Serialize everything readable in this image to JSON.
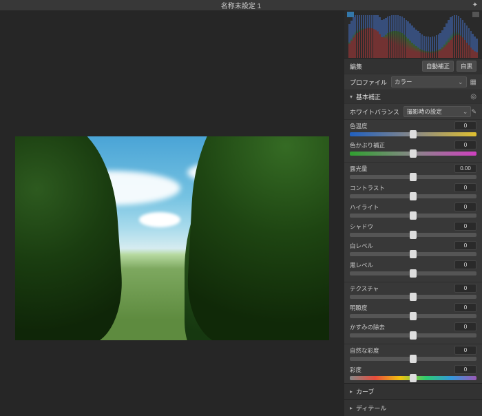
{
  "title": "名称未設定 1",
  "icons": {
    "gear": "✦"
  },
  "edit": {
    "header": "編集",
    "auto": "自動補正",
    "bw": "白黒",
    "profile_label": "プロファイル",
    "profile_value": "カラー"
  },
  "basic": {
    "title": "基本補正",
    "wb_label": "ホワイトバランス",
    "wb_value": "撮影時の設定",
    "sliders": [
      {
        "key": "temp",
        "label": "色温度",
        "value": "0",
        "cls": "temp",
        "pos": 50
      },
      {
        "key": "tint",
        "label": "色かぶり補正",
        "value": "0",
        "cls": "tint",
        "pos": 50
      }
    ],
    "group2": [
      {
        "key": "exposure",
        "label": "露光量",
        "value": "0.00",
        "pos": 50
      },
      {
        "key": "contrast",
        "label": "コントラスト",
        "value": "0",
        "pos": 50
      },
      {
        "key": "highlight",
        "label": "ハイライト",
        "value": "0",
        "pos": 50
      },
      {
        "key": "shadow",
        "label": "シャドウ",
        "value": "0",
        "pos": 50
      },
      {
        "key": "white",
        "label": "白レベル",
        "value": "0",
        "pos": 50
      },
      {
        "key": "black",
        "label": "黒レベル",
        "value": "0",
        "pos": 50
      }
    ],
    "group3": [
      {
        "key": "texture",
        "label": "テクスチャ",
        "value": "0",
        "pos": 50
      },
      {
        "key": "clarity",
        "label": "明瞭度",
        "value": "0",
        "pos": 50
      },
      {
        "key": "dehaze",
        "label": "かすみの除去",
        "value": "0",
        "pos": 50
      }
    ],
    "group4": [
      {
        "key": "vibrance",
        "label": "自然な彩度",
        "value": "0",
        "pos": 50
      },
      {
        "key": "sat",
        "label": "彩度",
        "value": "0",
        "cls": "sat",
        "pos": 50
      }
    ]
  },
  "sections": {
    "curve": "カーブ",
    "detail": "ディテール"
  }
}
